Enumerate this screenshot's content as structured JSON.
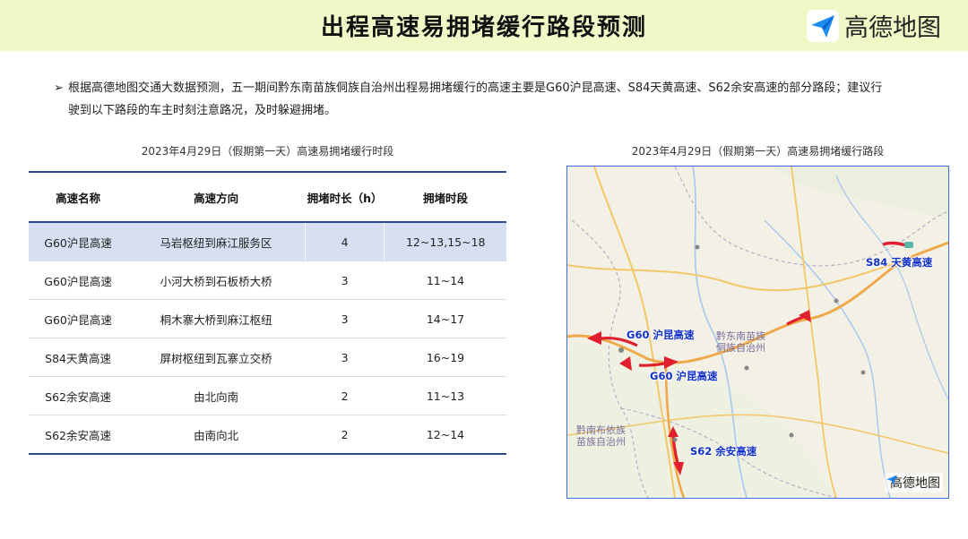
{
  "header": {
    "title": "出程高速易拥堵缓行路段预测",
    "brand": "高德地图",
    "bg_color": "#eff9c8"
  },
  "intro": {
    "bullet_icon": "arrow-right-icon",
    "line1": "根据高德地图交通大数据预测，五一期间黔东南苗族侗族自治州出程易拥堵缓行的高速主要是G60沪昆高速、S84天黄高速、S62余安高速的部分路段；建议行",
    "line2": "驶到以下路段的车主时刻注意路况，及时躲避拥堵。"
  },
  "table": {
    "caption": "2023年4月29日（假期第一天）高速易拥堵缓行时段",
    "headers": [
      "高速名称",
      "高速方向",
      "拥堵时长（h）",
      "拥堵时段"
    ],
    "rows": [
      {
        "name": "G60沪昆高速",
        "direction": "马岩枢纽到麻江服务区",
        "hours": "4",
        "period": "12~13,15~18"
      },
      {
        "name": "G60沪昆高速",
        "direction": "小河大桥到石板桥大桥",
        "hours": "3",
        "period": "11~14"
      },
      {
        "name": "G60沪昆高速",
        "direction": "桐木寨大桥到麻江枢纽",
        "hours": "3",
        "period": "14~17"
      },
      {
        "name": "S84天黄高速",
        "direction": "屏树枢纽到瓦寨立交桥",
        "hours": "3",
        "period": "16~19"
      },
      {
        "name": "S62余安高速",
        "direction": "由北向南",
        "hours": "2",
        "period": "11~13"
      },
      {
        "name": "S62余安高速",
        "direction": "由南向北",
        "hours": "2",
        "period": "12~14"
      }
    ],
    "accent_color": "#2c4a8c",
    "highlight_color": "#d7e0f2"
  },
  "map": {
    "caption": "2023年4月29日（假期第一天）高速易拥堵缓行路段",
    "labels": {
      "s84": "S84 天黄高速",
      "g60a": "G60 沪昆高速",
      "g60b": "G60 沪昆高速",
      "s62": "S62 余安高速"
    },
    "places": {
      "qdn1": "黔东南苗族",
      "qdn2": "侗族自治州",
      "qn1": "黔南布依族",
      "qn2": "苗族自治州"
    },
    "brand": "高德地图",
    "congestion_color": "#e0202e",
    "label_color": "#1030c8"
  }
}
